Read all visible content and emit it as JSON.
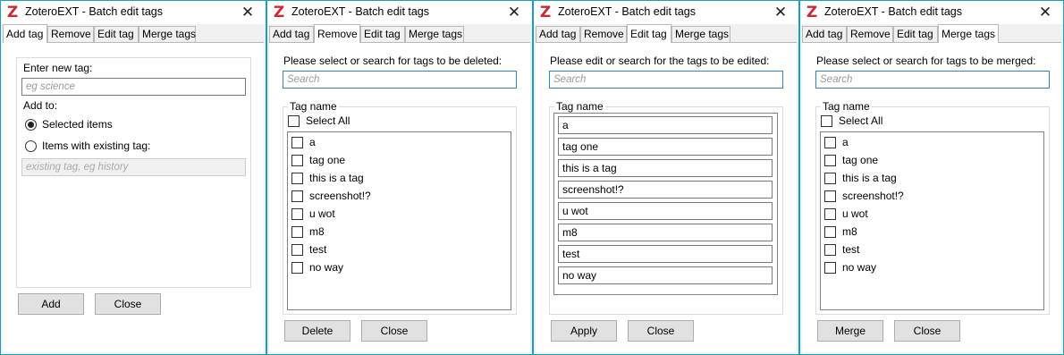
{
  "app": {
    "logo_glyph": "Z",
    "title": "ZoteroEXT - Batch edit tags",
    "close_glyph": "✕",
    "brand_color": "#cc2936"
  },
  "tabs": [
    {
      "label": "Add tag"
    },
    {
      "label": "Remove"
    },
    {
      "label": "Edit tag"
    },
    {
      "label": "Merge tags"
    }
  ],
  "add_tag": {
    "new_tag_label": "Enter new tag:",
    "new_tag_placeholder": "eg science",
    "add_to_label": "Add to:",
    "option_selected": "Selected items",
    "option_existing": "Items with existing tag:",
    "existing_placeholder": "existing tag, eg history",
    "selected_option": "Selected items",
    "add_button": "Add",
    "close_button": "Close"
  },
  "remove": {
    "prompt": "Please select or search for tags to be deleted:",
    "search_placeholder": "Search",
    "group_title": "Tag name",
    "select_all": "Select All",
    "delete_button": "Delete",
    "close_button": "Close"
  },
  "edit": {
    "prompt": "Please edit or search for the tags to be edited:",
    "search_placeholder": "Search",
    "group_title": "Tag name",
    "apply_button": "Apply",
    "close_button": "Close"
  },
  "merge": {
    "prompt": "Please select or search for tags to be merged:",
    "search_placeholder": "Search",
    "group_title": "Tag name",
    "select_all": "Select All",
    "merge_button": "Merge",
    "close_button": "Close"
  },
  "tags": [
    "a",
    "tag one",
    "this is a tag",
    "screenshot!?",
    "u wot",
    "m8",
    "test",
    "no way"
  ]
}
